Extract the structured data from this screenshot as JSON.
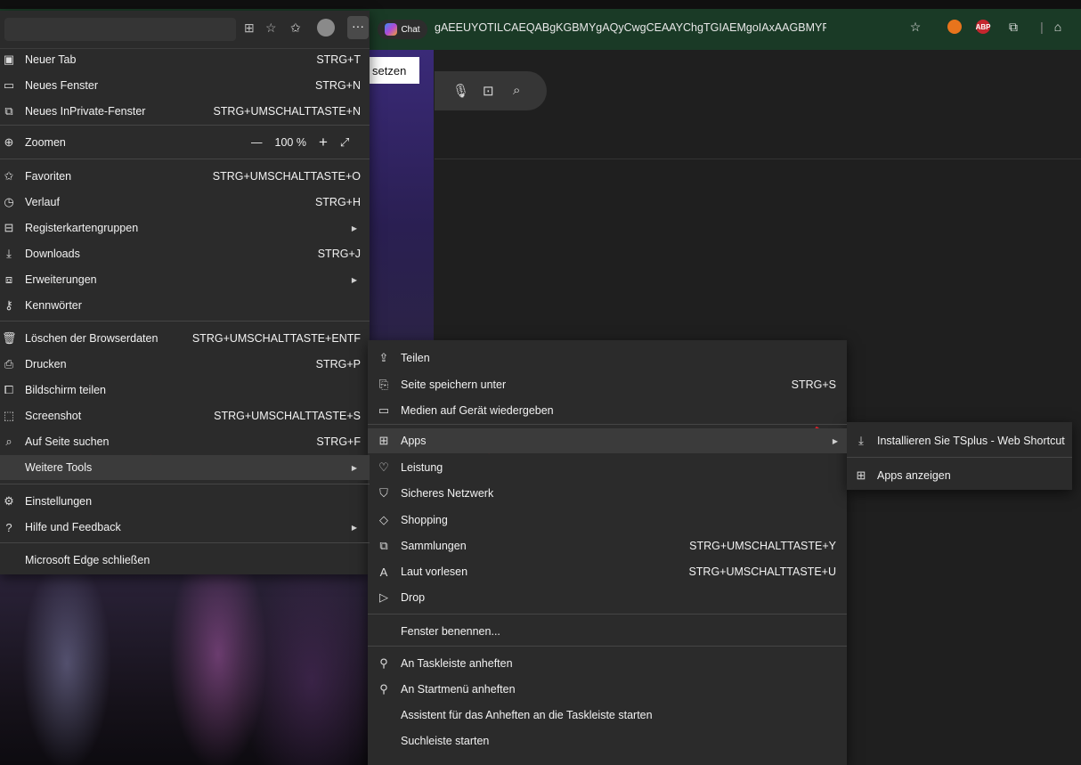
{
  "browser": {
    "address_text": "gAEEUYOTILCAEQABgKGBMYgAQyCwgCEAAYChgTGIAEMgoIAxAAGBMYFhgeMgwIBBAAG...",
    "chat_label": "Chat",
    "abp_badge": "ABP",
    "accent_color": "#1a3a26"
  },
  "page": {
    "setzen_label": "setzen"
  },
  "main_menu": {
    "items": [
      {
        "label": "Neuer Tab",
        "shortcut": "STRG+T",
        "icon": "new-tab-icon"
      },
      {
        "label": "Neues Fenster",
        "shortcut": "STRG+N",
        "icon": "window-icon"
      },
      {
        "label": "Neues InPrivate-Fenster",
        "shortcut": "STRG+UMSCHALTTASTE+N",
        "icon": "inprivate-icon"
      },
      {
        "label": "Zoomen",
        "icon": "zoom-icon"
      },
      {
        "label": "Favoriten",
        "shortcut": "STRG+UMSCHALTTASTE+O",
        "icon": "favorites-icon"
      },
      {
        "label": "Verlauf",
        "shortcut": "STRG+H",
        "icon": "history-icon"
      },
      {
        "label": "Registerkartengruppen",
        "icon": "tab-groups-icon"
      },
      {
        "label": "Downloads",
        "shortcut": "STRG+J",
        "icon": "download-icon"
      },
      {
        "label": "Erweiterungen",
        "icon": "extensions-icon"
      },
      {
        "label": "Kennwörter",
        "icon": "key-icon"
      },
      {
        "label": "Löschen der Browserdaten",
        "shortcut": "STRG+UMSCHALTTASTE+ENTF",
        "icon": "trash-icon"
      },
      {
        "label": "Drucken",
        "shortcut": "STRG+P",
        "icon": "print-icon"
      },
      {
        "label": "Bildschirm teilen",
        "icon": "screen-share-icon"
      },
      {
        "label": "Screenshot",
        "shortcut": "STRG+UMSCHALTTASTE+S",
        "icon": "screenshot-icon"
      },
      {
        "label": "Auf Seite suchen",
        "shortcut": "STRG+F",
        "icon": "find-icon"
      },
      {
        "label": "Weitere Tools"
      },
      {
        "label": "Einstellungen",
        "icon": "gear-icon"
      },
      {
        "label": "Hilfe und Feedback",
        "icon": "help-icon"
      },
      {
        "label": "Microsoft Edge schließen"
      }
    ],
    "zoom_value": "100 %",
    "zoom_minus": "—",
    "zoom_plus": "+"
  },
  "tools_menu": {
    "items": [
      {
        "label": "Teilen",
        "icon": "share-icon"
      },
      {
        "label": "Seite speichern unter",
        "shortcut": "STRG+S",
        "icon": "save-page-icon"
      },
      {
        "label": "Medien auf Gerät wiedergeben",
        "icon": "cast-icon"
      },
      {
        "label": "Apps",
        "icon": "apps-icon"
      },
      {
        "label": "Leistung",
        "icon": "performance-icon"
      },
      {
        "label": "Sicheres Netzwerk",
        "icon": "shield-icon"
      },
      {
        "label": "Shopping",
        "icon": "tag-icon"
      },
      {
        "label": "Sammlungen",
        "shortcut": "STRG+UMSCHALTTASTE+Y",
        "icon": "collections-icon"
      },
      {
        "label": "Laut vorlesen",
        "shortcut": "STRG+UMSCHALTTASTE+U",
        "icon": "read-aloud-icon"
      },
      {
        "label": "Drop",
        "icon": "drop-icon"
      },
      {
        "label": "Fenster benennen..."
      },
      {
        "label": "An Taskleiste anheften",
        "icon": "pin-icon"
      },
      {
        "label": "An Startmenü anheften",
        "icon": "pin-icon"
      },
      {
        "label": "Assistent für das Anheften an die Taskleiste starten"
      },
      {
        "label": "Suchleiste starten"
      }
    ]
  },
  "apps_menu": {
    "items": [
      {
        "label": "Installieren Sie TSplus - Web Shortcut",
        "icon": "download-icon"
      },
      {
        "label": "Apps anzeigen",
        "icon": "apps-icon"
      }
    ]
  },
  "annotation_color": "#e0202a"
}
